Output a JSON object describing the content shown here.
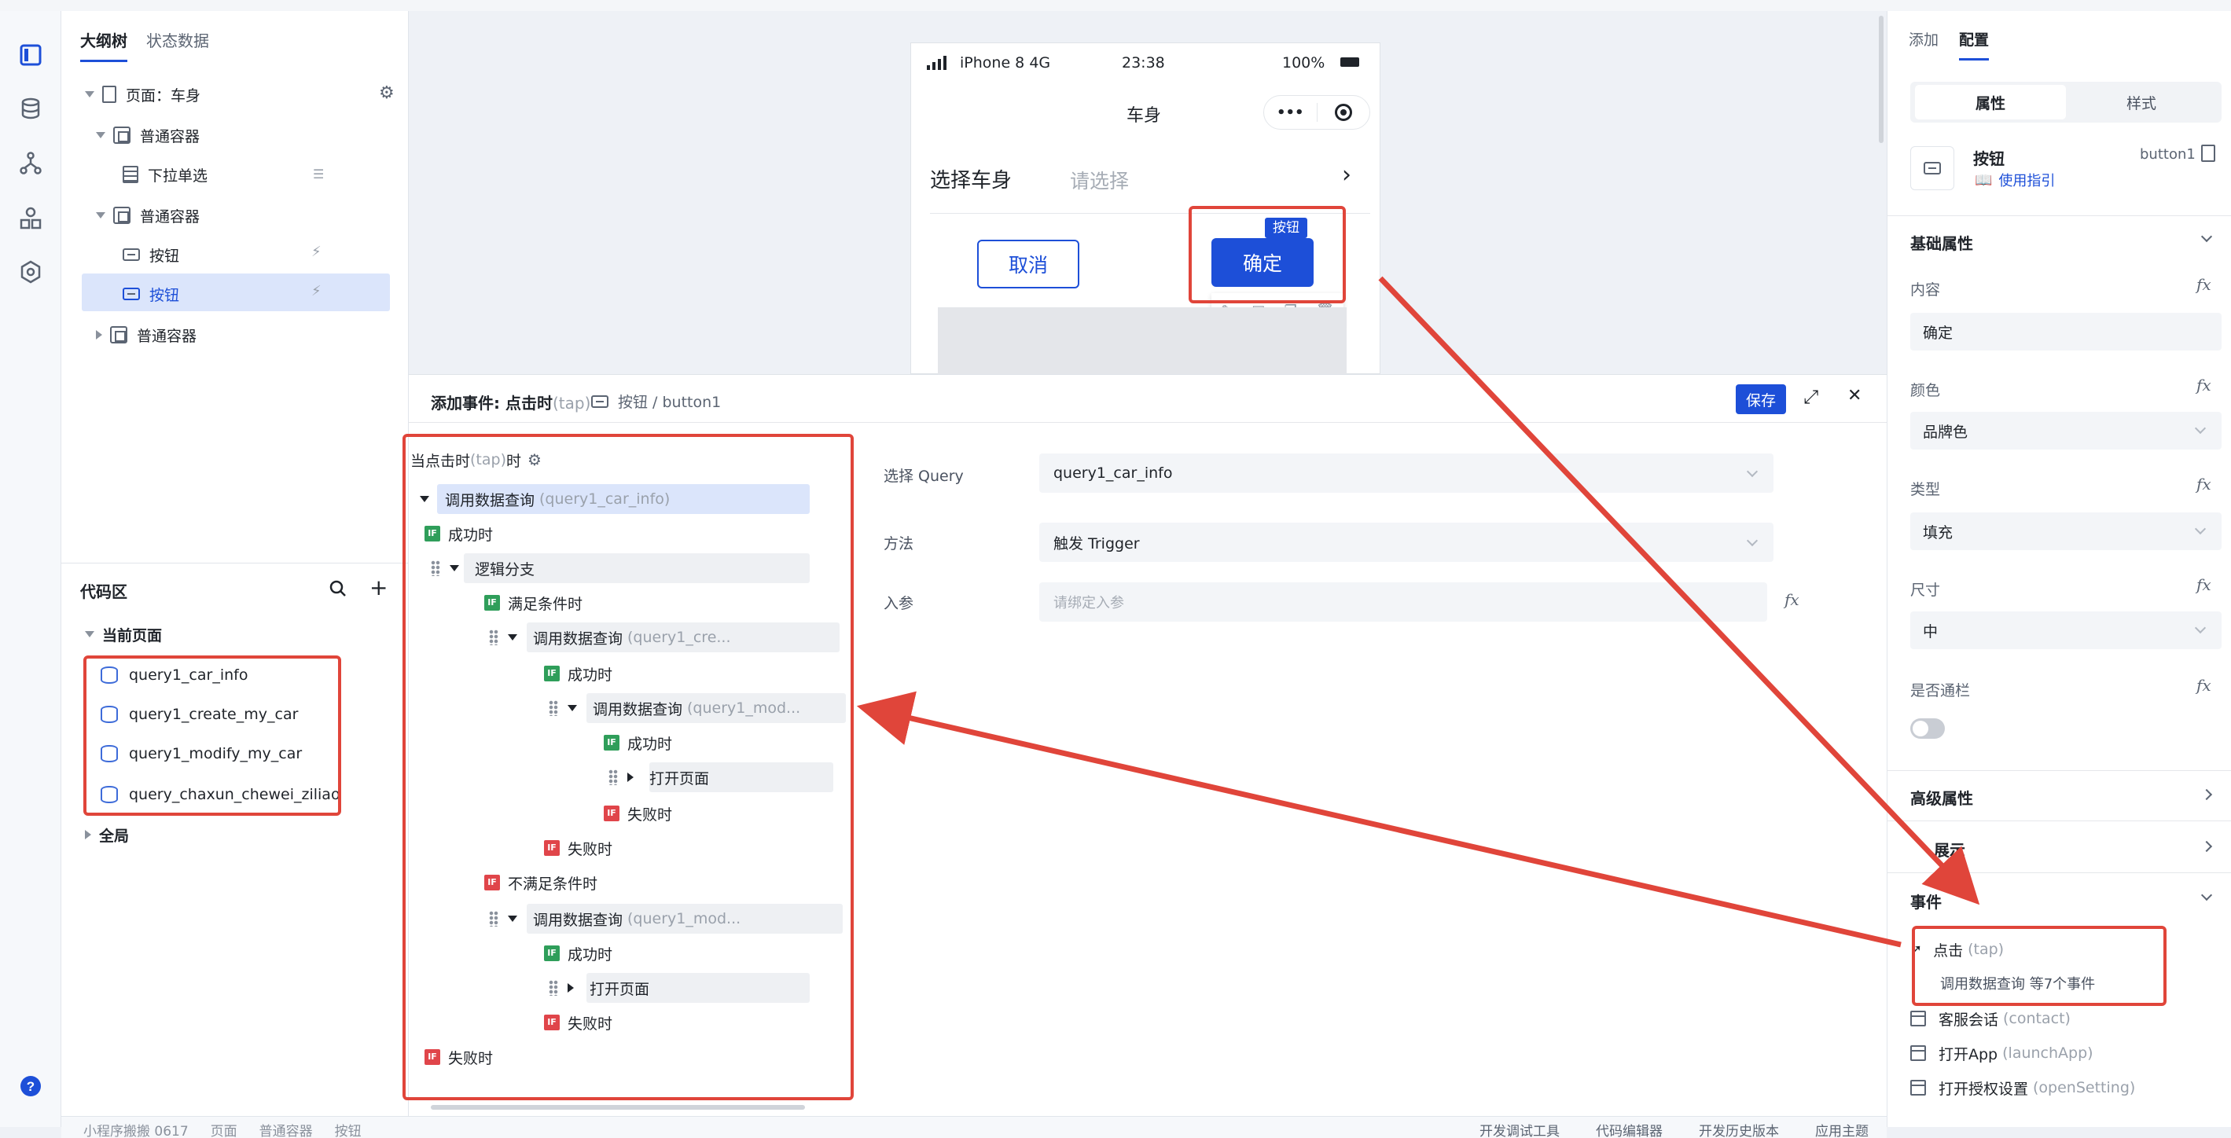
{
  "outline": {
    "tabs": [
      "大纲树",
      "状态数据"
    ],
    "page_label": "页面：车身",
    "nodes": {
      "container1": "普通容器",
      "dropdown": "下拉单选",
      "container2": "普通容器",
      "button1": "按钮",
      "button2": "按钮",
      "container3": "普通容器"
    }
  },
  "code": {
    "title": "代码区",
    "current_page": "当前页面",
    "queries": [
      "query1_car_info",
      "query1_create_my_car",
      "query1_modify_my_car",
      "query_chaxun_chewei_ziliao"
    ],
    "global": "全局"
  },
  "phone": {
    "carrier": "iPhone 8",
    "network": "4G",
    "time": "23:38",
    "battery": "100%",
    "title": "车身",
    "menu_dots": "•••",
    "select_label": "选择车身",
    "select_placeholder": "请选择",
    "select_arrow": "›",
    "cancel": "取消",
    "confirm": "确定",
    "badge": "按钮"
  },
  "event": {
    "title": "添加事件: 点击时",
    "title_sub": "(tap)",
    "target": "按钮 / button1",
    "save": "保存",
    "expand": "⤢",
    "close": "✕",
    "trigger_prefix": "当点击时",
    "trigger_sub": "(tap)",
    "trigger_suffix": "时",
    "flow": {
      "call": "调用数据查询",
      "call1_sub": "(query1_car_info)",
      "call2_sub": "(query1_cre...",
      "call3_sub": "(query1_mod...",
      "call4_sub": "(query1_mod...",
      "success": "成功时",
      "fail": "失败时",
      "branch": "逻辑分支",
      "cond_yes": "满足条件时",
      "cond_no": "不满足条件时",
      "open_page": "打开页面",
      "if_tag": "IF"
    },
    "form": {
      "query_label": "选择 Query",
      "query_value": "query1_car_info",
      "method_label": "方法",
      "method_value": "触发 Trigger",
      "param_label": "入参",
      "param_placeholder": "请绑定入参",
      "fx": "fx"
    }
  },
  "props": {
    "tabs": [
      "添加",
      "配置"
    ],
    "seg": [
      "属性",
      "样式"
    ],
    "component_name": "按钮",
    "component_id": "button1",
    "guide": "使用指引",
    "basic_section": "基础属性",
    "content_label": "内容",
    "content_value": "确定",
    "color_label": "颜色",
    "color_value": "品牌色",
    "type_label": "类型",
    "type_value": "填充",
    "size_label": "尺寸",
    "size_value": "中",
    "block_label": "是否通栏",
    "advanced_section": "高级属性",
    "display_section": "展示",
    "events_section": "事件",
    "events": {
      "tap_label": "点击",
      "tap_sub": "(tap)",
      "tap_summary": "调用数据查询 等7个事件",
      "contact_label": "客服会话",
      "contact_sub": "(contact)",
      "launch_label": "打开App",
      "launch_sub": "(launchApp)",
      "setting_label": "打开授权设置",
      "setting_sub": "(openSetting)"
    },
    "fx": "fx"
  },
  "statusbar": {
    "breadcrumb": [
      "小程序搬搬 0617",
      "页面",
      "普通容器",
      "按钮"
    ],
    "tools": [
      "开发调试工具",
      "代码编辑器",
      "开发历史版本",
      "应用主题"
    ]
  },
  "colors": {
    "brand": "#1d4fd8",
    "highlight": "#dbe5fb",
    "annotation_red": "#e0453a"
  }
}
